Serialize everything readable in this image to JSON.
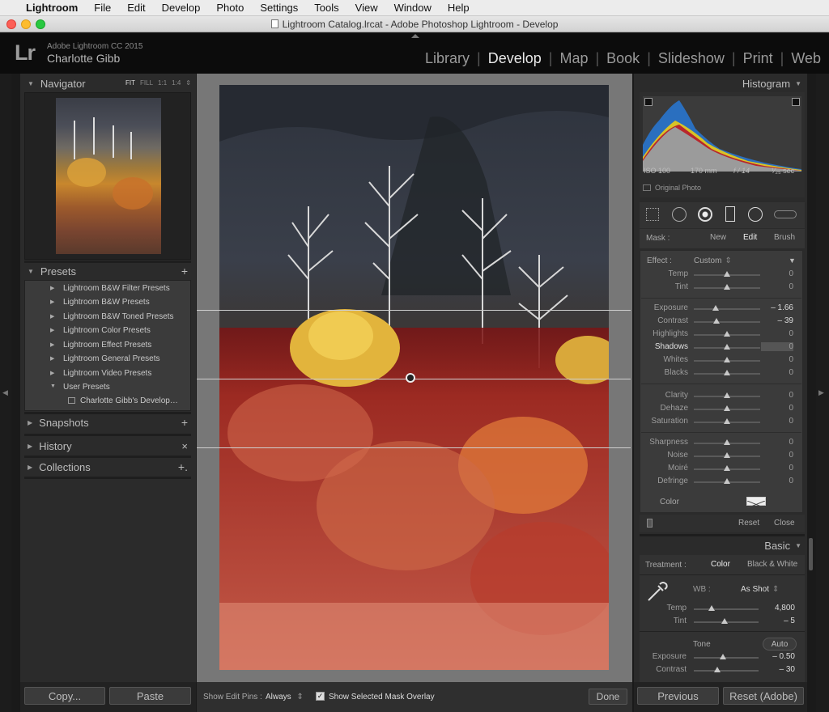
{
  "menubar": {
    "app_name": "Lightroom",
    "items": [
      "File",
      "Edit",
      "Develop",
      "Photo",
      "Settings",
      "Tools",
      "View",
      "Window",
      "Help"
    ]
  },
  "window": {
    "title": "Lightroom Catalog.lrcat - Adobe Photoshop Lightroom - Develop"
  },
  "identity": {
    "logo": "Lr",
    "product": "Adobe Lightroom CC 2015",
    "user": "Charlotte Gibb",
    "modules": [
      "Library",
      "Develop",
      "Map",
      "Book",
      "Slideshow",
      "Print",
      "Web"
    ],
    "active_module": "Develop"
  },
  "left": {
    "navigator": {
      "title": "Navigator",
      "zoom": [
        "FIT",
        "FILL",
        "1:1",
        "1:4"
      ]
    },
    "presets": {
      "title": "Presets",
      "add_label": "+",
      "items": [
        "Lightroom B&W Filter Presets",
        "Lightroom B&W Presets",
        "Lightroom B&W Toned Presets",
        "Lightroom Color Presets",
        "Lightroom Effect Presets",
        "Lightroom General Presets",
        "Lightroom Video Presets",
        "User Presets"
      ],
      "sub_item": "Charlotte Gibb's Develop…"
    },
    "snapshots": {
      "title": "Snapshots",
      "add_label": "+"
    },
    "history": {
      "title": "History",
      "clear_label": "×"
    },
    "collections": {
      "title": "Collections",
      "add_label": "+."
    },
    "copy_label": "Copy...",
    "paste_label": "Paste"
  },
  "toolbar": {
    "edit_pins_label": "Show Edit Pins :",
    "edit_pins_value": "Always",
    "mask_overlay_label": "Show Selected Mask Overlay",
    "done_label": "Done"
  },
  "right": {
    "histogram": {
      "title": "Histogram",
      "iso": "ISO 100",
      "focal": "170 mm",
      "aperture": "f / 14",
      "shutter": "¹⁄₂₅ sec",
      "original_photo": "Original Photo"
    },
    "mask": {
      "label": "Mask :",
      "new": "New",
      "edit": "Edit",
      "brush": "Brush"
    },
    "effect": {
      "label": "Effect :",
      "value": "Custom"
    },
    "groups": [
      [
        {
          "name": "Temp",
          "value": "0",
          "pos": 0.5
        },
        {
          "name": "Tint",
          "value": "0",
          "pos": 0.5
        }
      ],
      [
        {
          "name": "Exposure",
          "value": "– 1.66",
          "pos": 0.33
        },
        {
          "name": "Contrast",
          "value": "– 39",
          "pos": 0.34
        },
        {
          "name": "Highlights",
          "value": "0",
          "pos": 0.5
        },
        {
          "name": "Shadows",
          "value": "0",
          "pos": 0.5,
          "active": true
        },
        {
          "name": "Whites",
          "value": "0",
          "pos": 0.5
        },
        {
          "name": "Blacks",
          "value": "0",
          "pos": 0.5
        }
      ],
      [
        {
          "name": "Clarity",
          "value": "0",
          "pos": 0.5
        },
        {
          "name": "Dehaze",
          "value": "0",
          "pos": 0.5
        },
        {
          "name": "Saturation",
          "value": "0",
          "pos": 0.5
        }
      ],
      [
        {
          "name": "Sharpness",
          "value": "0",
          "pos": 0.5
        },
        {
          "name": "Noise",
          "value": "0",
          "pos": 0.5
        },
        {
          "name": "Moiré",
          "value": "0",
          "pos": 0.5
        },
        {
          "name": "Defringe",
          "value": "0",
          "pos": 0.5
        }
      ]
    ],
    "color_label": "Color",
    "reset_label": "Reset",
    "close_label": "Close",
    "basic": {
      "title": "Basic",
      "treatment_label": "Treatment :",
      "color": "Color",
      "bw": "Black & White",
      "wb_label": "WB :",
      "wb_value": "As Shot",
      "sliders": [
        {
          "name": "Temp",
          "value": "4,800",
          "pos": 0.28
        },
        {
          "name": "Tint",
          "value": "– 5",
          "pos": 0.47
        }
      ],
      "tone_label": "Tone",
      "auto_label": "Auto",
      "tone_sliders": [
        {
          "name": "Exposure",
          "value": "– 0.50",
          "pos": 0.45
        },
        {
          "name": "Contrast",
          "value": "– 30",
          "pos": 0.36
        }
      ]
    },
    "previous_label": "Previous",
    "reset_adobe_label": "Reset (Adobe)"
  }
}
